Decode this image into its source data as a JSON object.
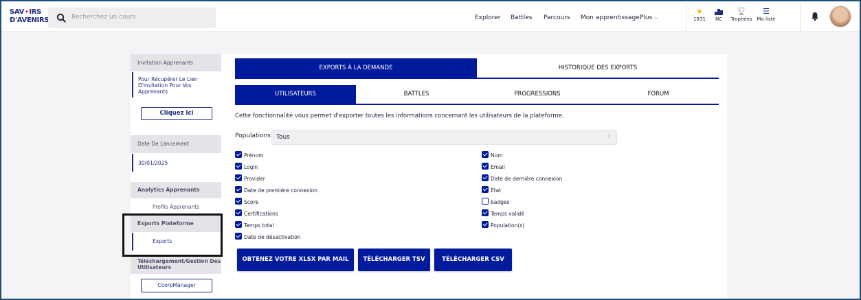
{
  "header": {
    "logo_line1": "SAV",
    "logo_line1b": "IRS",
    "logo_line2": "D'AVENIRS",
    "search_placeholder": "Recherchez un cours",
    "nav": [
      "Explorer",
      "Battles",
      "Parcours",
      "Mon apprentissage"
    ],
    "plus_label": "Plus",
    "stats": [
      {
        "icon": "star-icon",
        "value": "1831",
        "color": "#f5b800"
      },
      {
        "icon": "podium-icon",
        "value": "NC",
        "color": "#1d2d7c"
      },
      {
        "icon": "trophy-icon",
        "value": "Trophées",
        "color": "#9aa0b4"
      },
      {
        "icon": "list-icon",
        "value": "Ma liste",
        "color": "#1d2d7c"
      }
    ]
  },
  "sidebar": {
    "invitation_title": "Invitation Apprenants",
    "invitation_text": [
      "Pour Récupérer Le Lien",
      "D'invitation Pour Vos",
      "Apprenants"
    ],
    "invitation_button": "Cliquez Ici",
    "launch_title": "Date De Lancement",
    "launch_date": "30/01/2025",
    "analytics_title": "Analytics Apprenants",
    "analytics_item": "Profils Apprenants",
    "exports_title": "Exports Plateforme",
    "exports_item": "Exports",
    "download_title": [
      "Téléchargement/Gestion Des",
      "Utilisateurs"
    ],
    "download_button": "CoorpManager"
  },
  "tabs_top": [
    "EXPORTS À LA DEMANDE",
    "HISTORIQUE DES EXPORTS"
  ],
  "tabs_sub": [
    "UTILISATEURS",
    "BATTLES",
    "PROGRESSIONS",
    "FORUM"
  ],
  "description": "Cette fonctionnalité vous permet d'exporter toutes les informations concernant les utilisateurs de la plateforme.",
  "populations": {
    "label": "Populations",
    "value": "Tous"
  },
  "checkboxes_left": [
    {
      "label": "Prénom",
      "checked": true
    },
    {
      "label": "Login",
      "checked": true
    },
    {
      "label": "Provider",
      "checked": true
    },
    {
      "label": "Date de première connexion",
      "checked": true
    },
    {
      "label": "Score",
      "checked": true
    },
    {
      "label": "Certifications",
      "checked": true
    },
    {
      "label": "Temps total",
      "checked": true
    },
    {
      "label": "Date de désactivation",
      "checked": true
    }
  ],
  "checkboxes_right": [
    {
      "label": "Nom",
      "checked": true
    },
    {
      "label": "Email",
      "checked": true
    },
    {
      "label": "Date de dernière connexion",
      "checked": true
    },
    {
      "label": "État",
      "checked": true
    },
    {
      "label": "badges",
      "checked": false
    },
    {
      "label": "Temps validé",
      "checked": true
    },
    {
      "label": "Population(s)",
      "checked": true
    }
  ],
  "buttons": [
    "OBTENEZ VOTRE XLSX PAR MAIL",
    "TÉLÉCHARGER TSV",
    "TÉLÉCHARGER CSV"
  ],
  "colors": {
    "primary": "#001a9e",
    "brand": "#1d2d7c",
    "accent_red": "#e6392e"
  }
}
